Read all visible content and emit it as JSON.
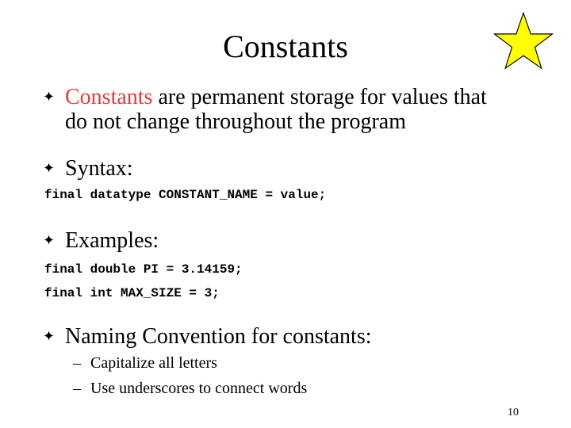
{
  "slide": {
    "title": "Constants",
    "bullet_mark": "✦",
    "bullets": [
      {
        "accent_word": "Constants",
        "text_line1": " are permanent storage for values that",
        "text_line2": "do not change throughout the program"
      },
      {
        "text": "Syntax:"
      },
      {
        "text": "Examples:"
      },
      {
        "text": "Naming Convention for constants:"
      }
    ],
    "syntax_code": "final datatype CONSTANT_NAME = value;",
    "example_code": [
      "final double PI = 3.14159;",
      "final int MAX_SIZE = 3;"
    ],
    "sub_dash": "–",
    "naming_items": [
      "Capitalize all letters",
      "Use underscores to connect words"
    ],
    "page_number": "10",
    "colors": {
      "accent": "#e33b3b",
      "star_fill": "#ffff00",
      "star_stroke": "#000000"
    },
    "icons": {
      "star": "star-icon"
    }
  }
}
